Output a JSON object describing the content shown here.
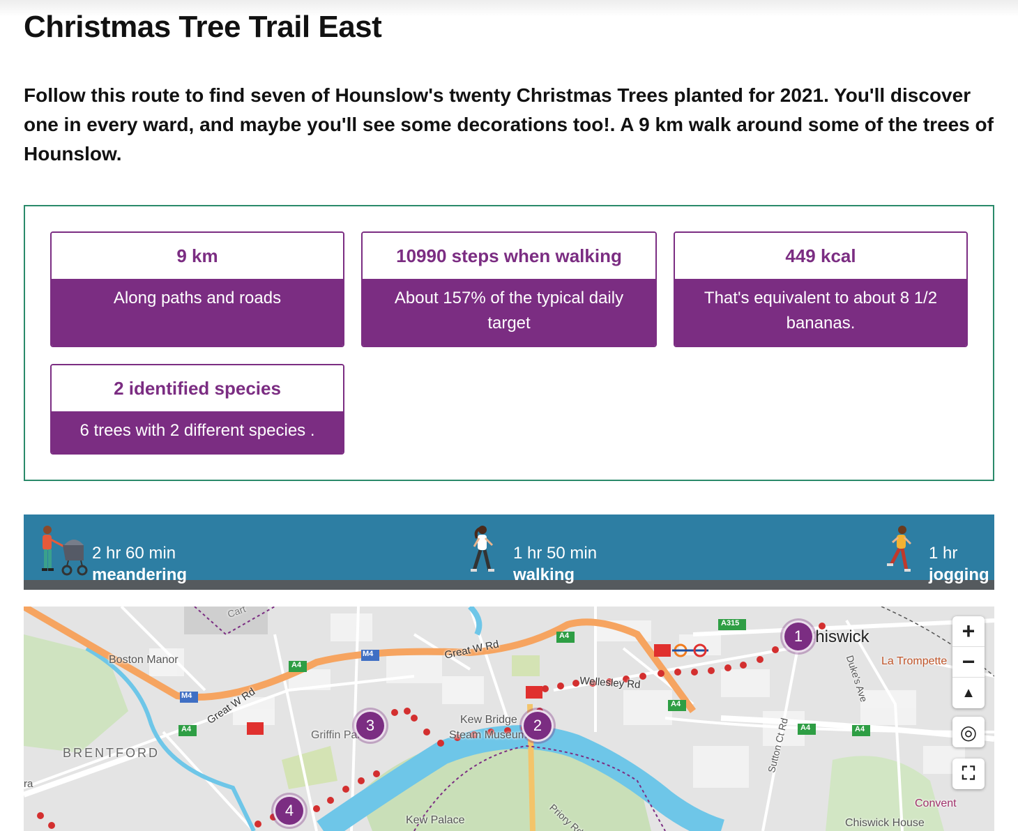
{
  "page": {
    "title": "Christmas Tree Trail East",
    "intro": "Follow this route to find seven of Hounslow's twenty Christmas Trees planted for 2021. You'll discover one in every ward, and maybe you'll see some decorations too!. A 9 km walk around some of the trees of Hounslow."
  },
  "stats": [
    {
      "head": "9 km",
      "body": "Along paths and roads"
    },
    {
      "head": "10990 steps when walking",
      "body": "About 157% of the typical daily target"
    },
    {
      "head": "449 kcal",
      "body": "That's equivalent to about 8 1/2 bananas."
    },
    {
      "head": "2 identified species",
      "body": "6 trees with 2 different species ."
    }
  ],
  "speeds": [
    {
      "duration": "2 hr 60 min",
      "mode": "meandering",
      "icon": "pram-walker-icon"
    },
    {
      "duration": "1 hr 50 min",
      "mode": "walking",
      "icon": "walker-icon"
    },
    {
      "duration": "1 hr",
      "mode": "jogging",
      "icon": "jogger-icon"
    }
  ],
  "map": {
    "labels": {
      "boston_manor": "Boston Manor",
      "brentford": "BRENTFORD",
      "griffin_park": "Griffin Park",
      "kew_bridge": "Kew Bridge",
      "steam_museum": "Steam Museum",
      "kew_palace": "Kew Palace",
      "priory_rd": "Priory Rd",
      "chiswick": "Chiswick",
      "la_trompette": "La Trompette",
      "dukes_ave": "Duke's Ave",
      "sutton_ct_rd": "Sutton Ct Rd",
      "chiswick_house": "Chiswick House",
      "convent": "Convent",
      "wellesley_rd": "Wellesley Rd",
      "great_w_rd_1": "Great W Rd",
      "great_w_rd_2": "Great W Rd",
      "m4_1": "M4",
      "m4_2": "M4",
      "a4_1": "A4",
      "a4_2": "A4",
      "a4_3": "A4",
      "a4_4": "A4",
      "a4_5": "A4",
      "a4_6": "A4",
      "a315": "A315",
      "cart": "Cart",
      "ra": "ra"
    },
    "markers": [
      "1",
      "2",
      "3",
      "4"
    ],
    "controls": {
      "zoom_in": "+",
      "zoom_out": "−",
      "compass": "▲",
      "locate": "◎",
      "fullscreen": "⛶"
    },
    "colors": {
      "route": "#d32f2f",
      "marker": "#7b2d82",
      "river": "#6ec6e8",
      "motorway": "#f6a460",
      "park": "#c9dfb8"
    }
  }
}
